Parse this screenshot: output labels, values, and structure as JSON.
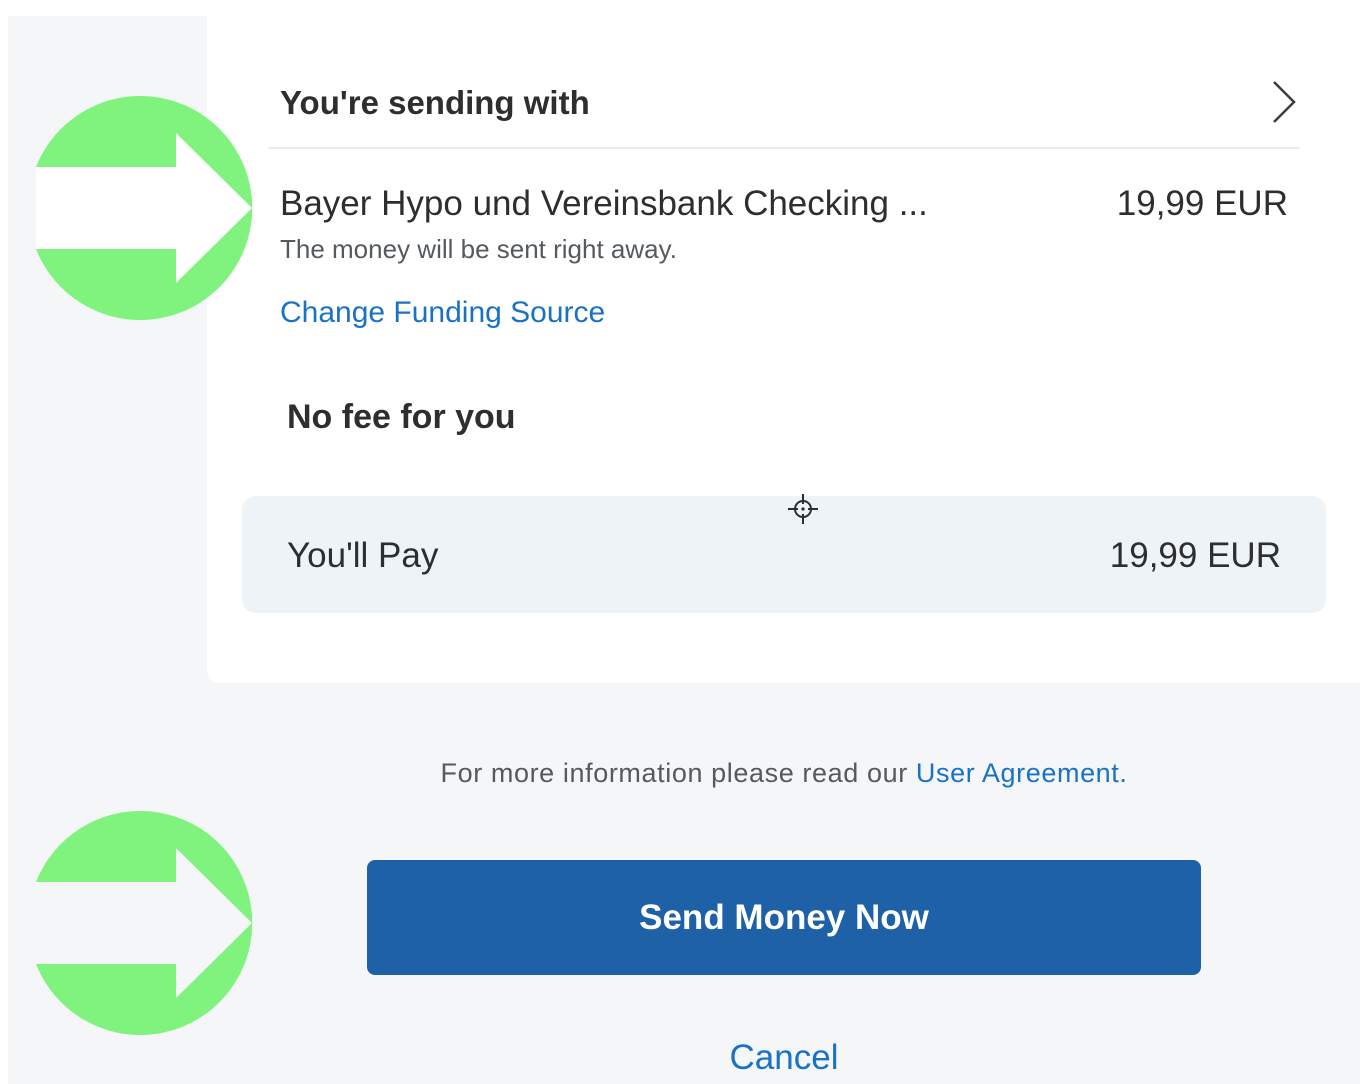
{
  "funding": {
    "heading": "You're sending with",
    "source_name": "Bayer Hypo und Vereinsbank Checking ...",
    "source_amount": "19,99 EUR",
    "source_note": "The money will be sent right away.",
    "change_link": "Change Funding Source"
  },
  "fee": {
    "heading": "No fee for you"
  },
  "summary": {
    "pay_label": "You'll Pay",
    "pay_amount": "19,99 EUR"
  },
  "footer": {
    "agreement_text": "For more information please read our ",
    "agreement_link": "User Agreement",
    "agreement_end": ".",
    "send_button": "Send Money Now",
    "cancel_link": "Cancel"
  },
  "icons": {
    "chevron": "chevron-right-icon",
    "arrow": "arrow-right-icon",
    "cursor": "move-cursor-icon"
  },
  "colors": {
    "accent_link": "#1a72c7",
    "primary_button": "#1f61a6",
    "highlight_arrow": "#80f27e",
    "pay_box_bg": "#edf3f7"
  }
}
